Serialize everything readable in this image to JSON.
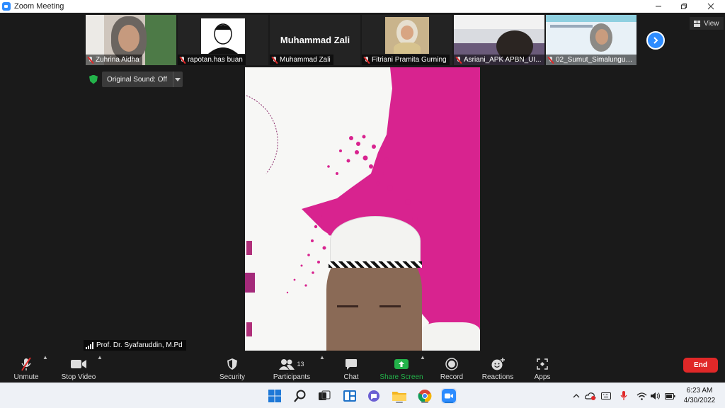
{
  "window": {
    "title": "Zoom Meeting"
  },
  "thumbnails": [
    {
      "name": "Zuhrina Aidha"
    },
    {
      "name": "rapotan.has buan"
    },
    {
      "name": "Muhammad Zali",
      "display_name": "Muhammad Zali"
    },
    {
      "name": "Fitriani Pramita Gurning"
    },
    {
      "name": "Asriani_APK APBN_UI..."
    },
    {
      "name": "02_Sumut_Simalungun..."
    }
  ],
  "view_label": "View",
  "original_sound": "Original Sound: Off",
  "active_speaker": "Prof. Dr. Syafaruddin, M.Pd",
  "toolbar": {
    "unmute": "Unmute",
    "stop_video": "Stop Video",
    "security": "Security",
    "participants": "Participants",
    "participant_count": "13",
    "chat": "Chat",
    "share_screen": "Share Screen",
    "record": "Record",
    "reactions": "Reactions",
    "apps": "Apps",
    "end": "End"
  },
  "clock": {
    "time": "6:23 AM",
    "date": "4/30/2022"
  },
  "colors": {
    "accent": "#2d8cff",
    "share_green": "#23b34a",
    "end_red": "#e02828",
    "banner_pink": "#d8238f"
  }
}
